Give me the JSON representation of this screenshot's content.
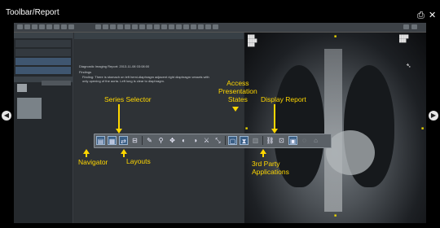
{
  "window": {
    "title": "Toolbar/Report",
    "icons": [
      "print-icon",
      "close-icon"
    ]
  },
  "navigation": {
    "prev_icon": "chevron-left-icon",
    "next_icon": "chevron-right-icon"
  },
  "callouts": {
    "series_selector": "Series Selector",
    "access_presentation_states": [
      "Access",
      "Presentation",
      "States"
    ],
    "display_report": "Display Report",
    "navigator": "Navigator",
    "layouts": "Layouts",
    "third_party_apps": [
      "3rd Party",
      "Applications"
    ]
  },
  "report": {
    "title": "Diagnostic Imaging Report: 2013-11-08 03:08:00",
    "section": "Findings",
    "findings_line1": "Finding: There is stomach on left hemi-diaphragm adjacent right diaphragm vessels with",
    "findings_line2": "only opening of the aorta. Left lung is clear to diaphragm."
  },
  "toolbar": {
    "tools": [
      {
        "name": "navigator-icon",
        "glyph": "▤"
      },
      {
        "name": "series-grid-icon",
        "glyph": "▦"
      },
      {
        "name": "series-selector-icon",
        "glyph": "⇄"
      },
      {
        "name": "layouts-icon",
        "glyph": "⊟"
      },
      {
        "name": "pencil-icon",
        "glyph": "✎"
      },
      {
        "name": "zoom-icon",
        "glyph": "⚲"
      },
      {
        "name": "pan-icon",
        "glyph": "✥"
      },
      {
        "name": "window-level-icon",
        "glyph": "◐"
      },
      {
        "name": "invert-icon",
        "glyph": "◑"
      },
      {
        "name": "measure-icon",
        "glyph": "⚔"
      },
      {
        "name": "annotation-icon",
        "glyph": "⤡"
      },
      {
        "name": "presentation-states-icon",
        "glyph": "▢"
      },
      {
        "name": "key-images-icon",
        "glyph": "⧗"
      },
      {
        "name": "hide-icon",
        "glyph": "▥"
      },
      {
        "name": "link-icon",
        "glyph": "⛓"
      },
      {
        "name": "third-party-apps-icon",
        "glyph": "⊡"
      },
      {
        "name": "display-report-icon",
        "glyph": "▣"
      },
      {
        "name": "tool-dim-1-icon",
        "glyph": "◌"
      },
      {
        "name": "tool-dim-2-icon",
        "glyph": "⌂"
      }
    ]
  }
}
